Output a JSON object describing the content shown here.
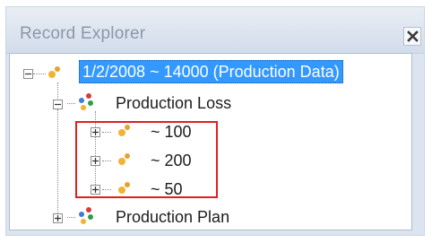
{
  "panel": {
    "title": "Record Explorer",
    "close_icon": "close-icon"
  },
  "tree": {
    "root": {
      "label": "1/2/2008 ~ 14000 (Production Data)",
      "state": "expanded",
      "selected": true,
      "icon": "record-icon"
    },
    "children": [
      {
        "label": "Production Loss",
        "state": "expanded",
        "icon": "family-icon",
        "items": [
          {
            "label": "~ 100",
            "state": "collapsed",
            "icon": "record-icon"
          },
          {
            "label": "~ 200",
            "state": "collapsed",
            "icon": "record-icon"
          },
          {
            "label": "~ 50",
            "state": "collapsed",
            "icon": "record-icon"
          }
        ]
      },
      {
        "label": "Production Plan",
        "state": "collapsed",
        "icon": "family-icon"
      }
    ]
  },
  "colors": {
    "selection": "#3398ff",
    "highlight_border": "#e21f1f",
    "title_text": "#8a98ab"
  }
}
